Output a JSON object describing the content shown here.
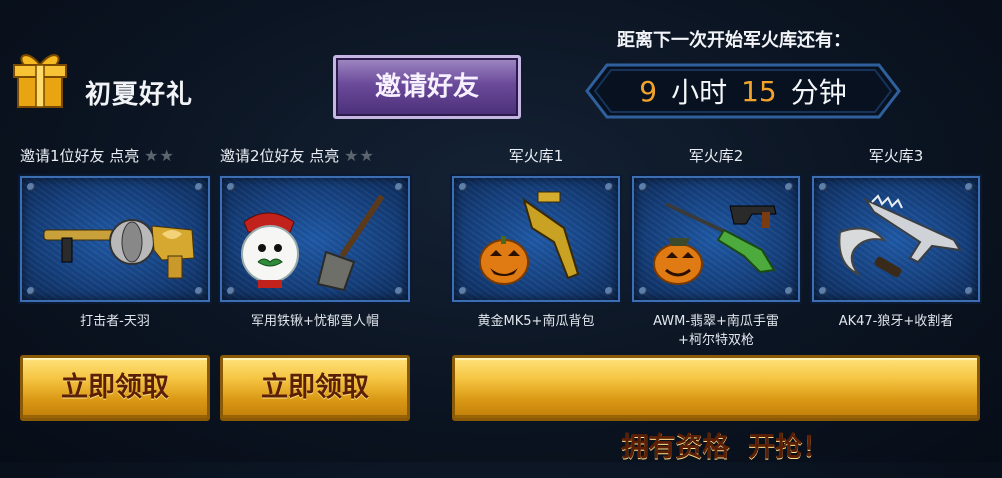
{
  "header": {
    "title": "初夏好礼",
    "invite_button": "邀请好友",
    "countdown_title": "距离下一次开始军火库还有：",
    "countdown": {
      "hours": "9",
      "hours_unit": "小时",
      "minutes": "15",
      "minutes_unit": "分钟"
    }
  },
  "invite_rewards": [
    {
      "label": "邀请1位好友 点亮",
      "stars": "★★",
      "caption": "打击者-天羽",
      "button": "立即领取"
    },
    {
      "label": "邀请2位好友 点亮",
      "stars": "★★",
      "caption": "军用铁锹+忧郁雪人帽",
      "button": "立即领取"
    }
  ],
  "arsenals": [
    {
      "label": "军火库1",
      "caption": "黄金MK5+南瓜背包"
    },
    {
      "label": "军火库2",
      "caption_line1": "AWM-翡翠+南瓜手雷",
      "caption_line2": "+柯尔特双枪"
    },
    {
      "label": "军火库3",
      "caption": "AK47-狼牙+收割者"
    }
  ],
  "grab_button": "拥有资格  开抢！",
  "colors": {
    "accent_gold": "#f5c441",
    "countdown_number": "#f2a32c",
    "invite_purple": "#6a4a9a",
    "card_blue": "#1f5aa8"
  }
}
